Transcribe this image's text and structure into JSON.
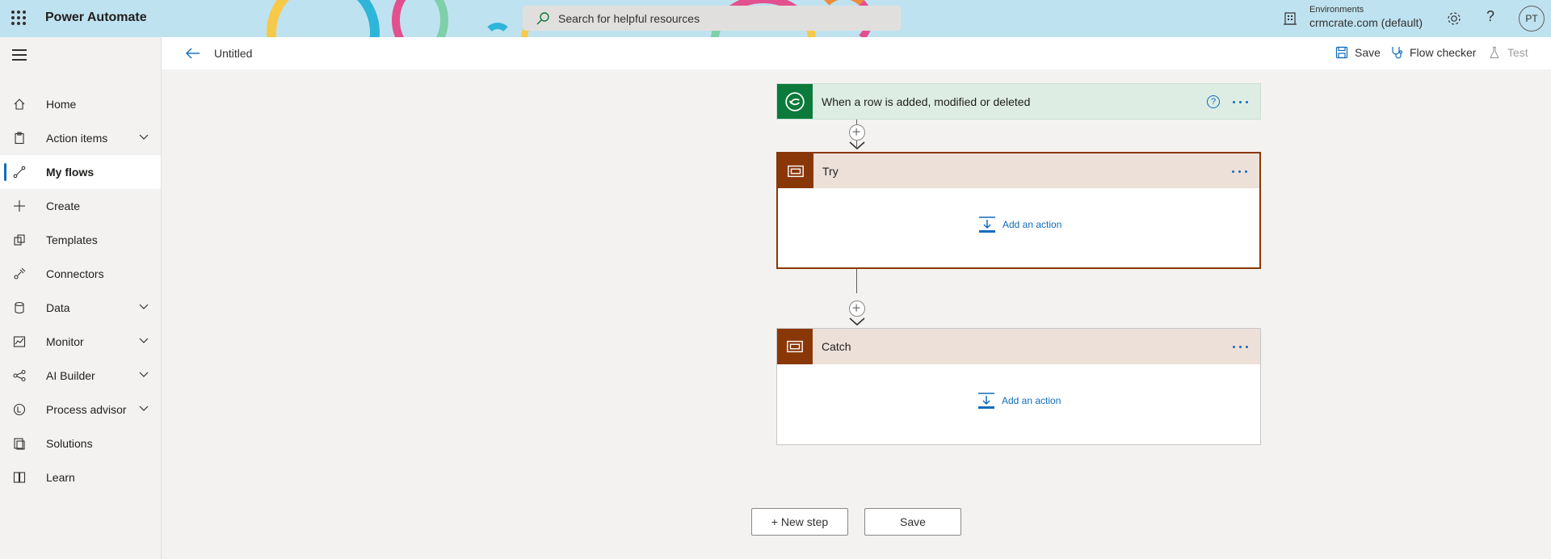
{
  "topbar": {
    "app_title": "Power Automate",
    "search_placeholder": "Search for helpful resources",
    "environment_label": "Environments",
    "environment_value": "crmcrate.com (default)",
    "help_glyph": "?",
    "avatar_initials": "PT",
    "theme_colors": [
      "#e3508f",
      "#f7c948",
      "#2fb5d9",
      "#f08a3c",
      "#7ed0a8",
      "#b97fd9"
    ]
  },
  "sidebar": {
    "items": [
      {
        "label": "Home",
        "icon": "home-icon",
        "chevron": false,
        "active": false
      },
      {
        "label": "Action items",
        "icon": "clipboard-icon",
        "chevron": true,
        "active": false
      },
      {
        "label": "My flows",
        "icon": "flow-icon",
        "chevron": false,
        "active": true
      },
      {
        "label": "Create",
        "icon": "plus-icon",
        "chevron": false,
        "active": false
      },
      {
        "label": "Templates",
        "icon": "templates-icon",
        "chevron": false,
        "active": false
      },
      {
        "label": "Connectors",
        "icon": "connector-icon",
        "chevron": false,
        "active": false
      },
      {
        "label": "Data",
        "icon": "database-icon",
        "chevron": true,
        "active": false
      },
      {
        "label": "Monitor",
        "icon": "monitor-icon",
        "chevron": true,
        "active": false
      },
      {
        "label": "AI Builder",
        "icon": "ai-builder-icon",
        "chevron": true,
        "active": false
      },
      {
        "label": "Process advisor",
        "icon": "process-advisor-icon",
        "chevron": true,
        "active": false
      },
      {
        "label": "Solutions",
        "icon": "solutions-icon",
        "chevron": false,
        "active": false
      },
      {
        "label": "Learn",
        "icon": "book-icon",
        "chevron": false,
        "active": false
      }
    ]
  },
  "header": {
    "flow_name": "Untitled",
    "save_label": "Save",
    "flow_checker_label": "Flow checker",
    "test_label": "Test"
  },
  "flow": {
    "trigger": {
      "title": "When a row is added, modified or deleted",
      "color": "#0b7a3a",
      "bg": "#ddede3"
    },
    "try": {
      "title": "Try",
      "add_action": "Add an action",
      "color": "#8a3707",
      "bg": "#ede0d9",
      "border": "#8a3707"
    },
    "catch": {
      "title": "Catch",
      "add_action": "Add an action",
      "color": "#8a3707",
      "bg": "#ede0d9"
    }
  },
  "footer": {
    "new_step_label": "+ New step",
    "save_label": "Save"
  }
}
